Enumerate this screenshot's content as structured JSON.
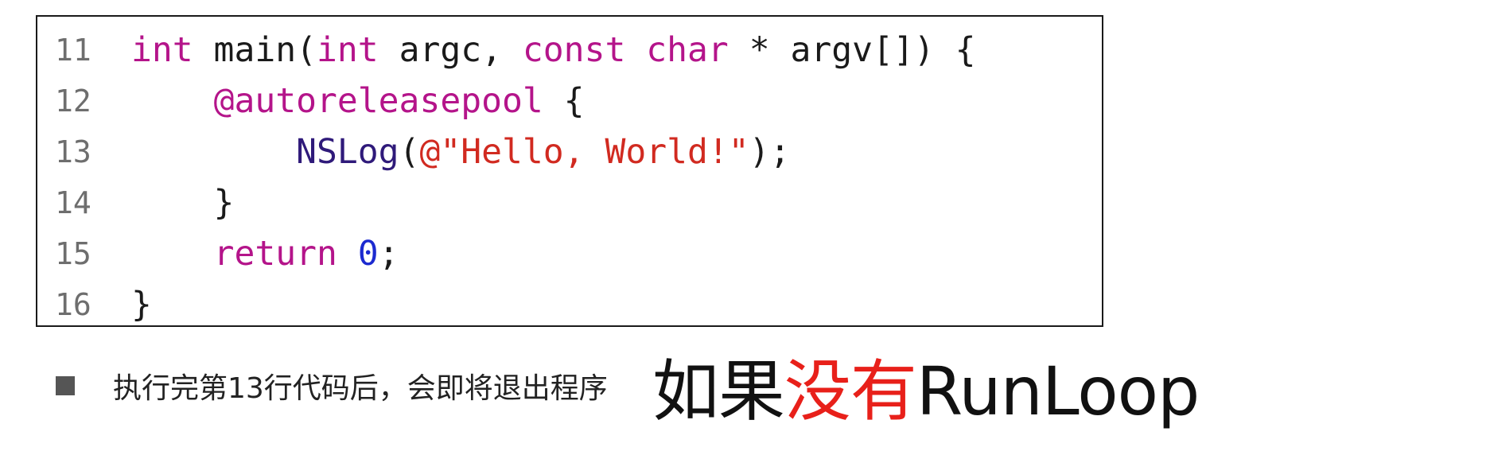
{
  "code_lines": [
    {
      "number": "11",
      "tokens": [
        {
          "text": "int",
          "kind": "keyword"
        },
        {
          "text": " main(",
          "kind": "plain"
        },
        {
          "text": "int",
          "kind": "keyword"
        },
        {
          "text": " argc, ",
          "kind": "plain"
        },
        {
          "text": "const",
          "kind": "keyword"
        },
        {
          "text": " ",
          "kind": "plain"
        },
        {
          "text": "char",
          "kind": "keyword"
        },
        {
          "text": " * argv[]) {",
          "kind": "plain"
        }
      ]
    },
    {
      "number": "12",
      "tokens": [
        {
          "text": "    ",
          "kind": "plain"
        },
        {
          "text": "@autoreleasepool",
          "kind": "keyword"
        },
        {
          "text": " {",
          "kind": "plain"
        }
      ]
    },
    {
      "number": "13",
      "tokens": [
        {
          "text": "        ",
          "kind": "plain"
        },
        {
          "text": "NSLog",
          "kind": "function"
        },
        {
          "text": "(",
          "kind": "plain"
        },
        {
          "text": "@\"Hello, World!\"",
          "kind": "string"
        },
        {
          "text": ");",
          "kind": "plain"
        }
      ]
    },
    {
      "number": "14",
      "tokens": [
        {
          "text": "    }",
          "kind": "plain"
        }
      ]
    },
    {
      "number": "15",
      "tokens": [
        {
          "text": "    ",
          "kind": "plain"
        },
        {
          "text": "return",
          "kind": "keyword"
        },
        {
          "text": " ",
          "kind": "plain"
        },
        {
          "text": "0",
          "kind": "number"
        },
        {
          "text": ";",
          "kind": "plain"
        }
      ]
    },
    {
      "number": "16",
      "tokens": [
        {
          "text": "}",
          "kind": "plain"
        }
      ]
    }
  ],
  "token_colors": {
    "keyword": "#b4148a",
    "function": "#2f1a7a",
    "string": "#d12a20",
    "number": "#1c2ad0",
    "plain": "#1a1a1a"
  },
  "note": {
    "bullet_icon": "square-bullet-icon",
    "text": "执行完第13行代码后，会即将退出程序"
  },
  "headline": {
    "part1": "如果",
    "part2": "没有",
    "part3": "RunLoop",
    "highlight_color": "#e8201a"
  }
}
